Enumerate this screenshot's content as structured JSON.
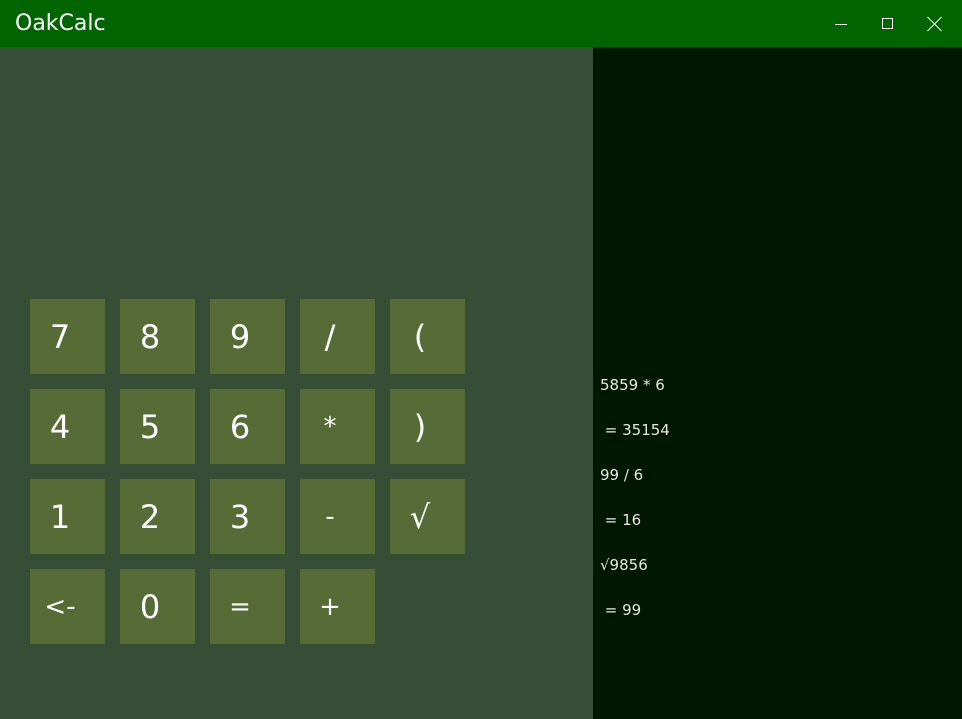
{
  "window": {
    "title": "OakCalc",
    "controls": [
      "minimize",
      "maximize",
      "close"
    ]
  },
  "colors": {
    "titlebar": "#006400",
    "keypad_background": "#364d36",
    "key_background": "#566b36",
    "history_background": "#001800",
    "text": "#ffffff"
  },
  "keypad": {
    "keys": [
      "7",
      "8",
      "9",
      "/",
      "(",
      "4",
      "5",
      "6",
      "*",
      ")",
      "1",
      "2",
      "3",
      "-",
      "√",
      "<-",
      "0",
      "=",
      "+"
    ]
  },
  "history": {
    "entries": [
      {
        "expression": "5859 * 6",
        "result": " = 35154"
      },
      {
        "expression": "99 / 6",
        "result": " = 16"
      },
      {
        "expression": "√9856",
        "result": " = 99"
      }
    ]
  }
}
